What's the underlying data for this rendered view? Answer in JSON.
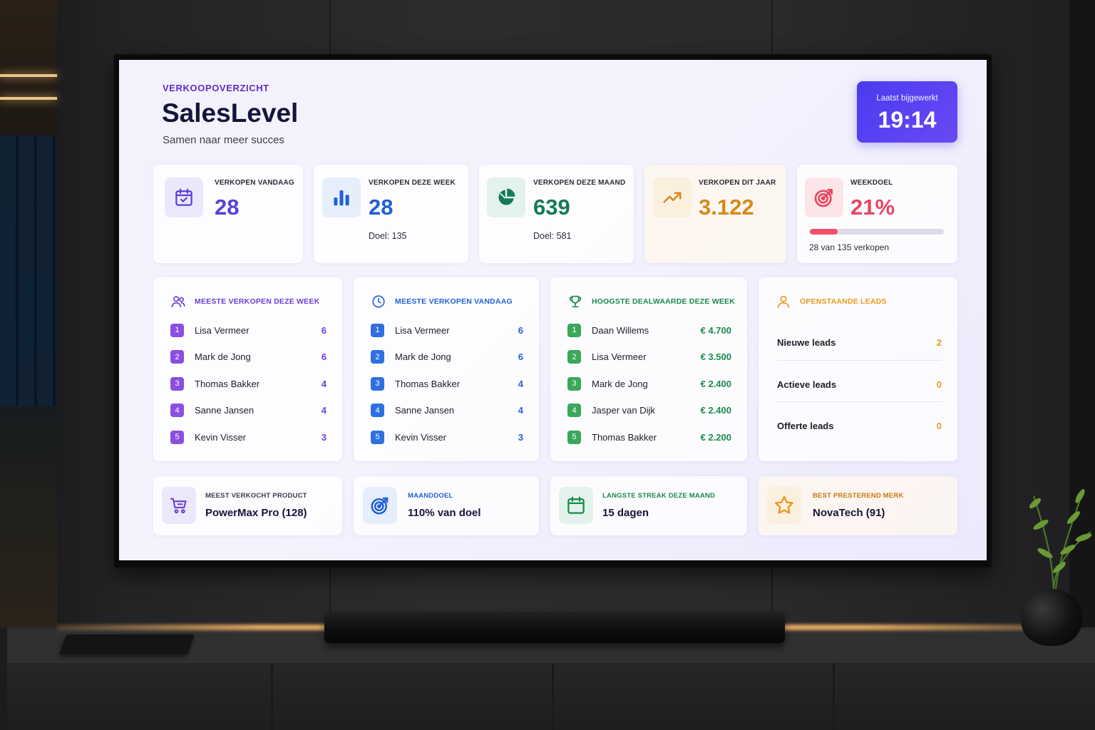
{
  "header": {
    "kicker": "VERKOOPOVERZICHT",
    "title": "SalesLevel",
    "subtitle": "Samen naar meer succes",
    "updated_label": "Laatst bijgewerkt",
    "updated_time": "19:14"
  },
  "stats": [
    {
      "label": "VERKOPEN VANDAAG",
      "value": "28",
      "goal": "",
      "icon": "calendar-check-icon",
      "color": "#5b3fd6",
      "tile": "#ece8fb"
    },
    {
      "label": "VERKOPEN DEZE WEEK",
      "value": "28",
      "goal": "Doel: 135",
      "icon": "bar-chart-icon",
      "color": "#1f5fd6",
      "tile": "#e6eefb"
    },
    {
      "label": "VERKOPEN DEZE MAAND",
      "value": "639",
      "goal": "Doel: 581",
      "icon": "pie-chart-icon",
      "color": "#137a55",
      "tile": "#e3f3ec"
    },
    {
      "label": "VERKOPEN DIT JAAR",
      "value": "3.122",
      "goal": "",
      "icon": "trending-up-icon",
      "color": "#d58a1a",
      "tile": "#fbf0de"
    },
    {
      "label": "WEEKDOEL",
      "value": "21%",
      "goal": "28 van 135 verkopen",
      "icon": "target-icon",
      "color": "#e84660",
      "tile": "#fce5e8",
      "progress": 0.21
    }
  ],
  "lists": [
    {
      "title": "MEESTE VERKOPEN DEZE WEEK",
      "icon": "users-icon",
      "color": "#6a3fd6",
      "rows": [
        {
          "rank": "1",
          "name": "Lisa Vermeer",
          "value": "6"
        },
        {
          "rank": "2",
          "name": "Mark de Jong",
          "value": "6"
        },
        {
          "rank": "3",
          "name": "Thomas Bakker",
          "value": "4"
        },
        {
          "rank": "4",
          "name": "Sanne Jansen",
          "value": "4"
        },
        {
          "rank": "5",
          "name": "Kevin Visser",
          "value": "3"
        }
      ]
    },
    {
      "title": "MEESTE VERKOPEN VANDAAG",
      "icon": "clock-icon",
      "color": "#2463d8",
      "rows": [
        {
          "rank": "1",
          "name": "Lisa Vermeer",
          "value": "6"
        },
        {
          "rank": "2",
          "name": "Mark de Jong",
          "value": "6"
        },
        {
          "rank": "3",
          "name": "Thomas Bakker",
          "value": "4"
        },
        {
          "rank": "4",
          "name": "Sanne Jansen",
          "value": "4"
        },
        {
          "rank": "5",
          "name": "Kevin Visser",
          "value": "3"
        }
      ]
    },
    {
      "title": "HOOGSTE DEALWAARDE DEZE WEEK",
      "icon": "trophy-icon",
      "color": "#1a8a4a",
      "rows": [
        {
          "rank": "1",
          "name": "Daan Willems",
          "value": "€ 4.700"
        },
        {
          "rank": "2",
          "name": "Lisa Vermeer",
          "value": "€ 3.500"
        },
        {
          "rank": "3",
          "name": "Mark de Jong",
          "value": "€ 2.400"
        },
        {
          "rank": "4",
          "name": "Jasper van Dijk",
          "value": "€ 2.400"
        },
        {
          "rank": "5",
          "name": "Thomas Bakker",
          "value": "€ 2.200"
        }
      ]
    }
  ],
  "leads": {
    "title": "OPENSTAANDE LEADS",
    "icon": "user-icon",
    "color": "#e89a1c",
    "rows": [
      {
        "name": "Nieuwe leads",
        "value": "2"
      },
      {
        "name": "Actieve leads",
        "value": "0"
      },
      {
        "name": "Offerte leads",
        "value": "0"
      }
    ]
  },
  "highlights": [
    {
      "label": "MEEST VERKOCHT PRODUCT",
      "value": "PowerMax Pro (128)",
      "icon": "cart-icon",
      "color": "#6a3fd6",
      "labelColor": "#3a3a48",
      "tile": "#ece8fb"
    },
    {
      "label": "MAANDDOEL",
      "value": "110% van doel",
      "icon": "target-icon",
      "color": "#1f5fd6",
      "labelColor": "#1f5fd6",
      "tile": "#e6eefb"
    },
    {
      "label": "LANGSTE STREAK DEZE MAAND",
      "value": "15 dagen",
      "icon": "calendar-icon",
      "color": "#1a8a4a",
      "labelColor": "#1a8a4a",
      "tile": "#e3f3ec"
    },
    {
      "label": "BEST PRESTEREND MERK",
      "value": "NovaTech (91)",
      "icon": "star-icon",
      "color": "#e89a1c",
      "labelColor": "#c77a10",
      "tile": "#fbf0de"
    }
  ]
}
